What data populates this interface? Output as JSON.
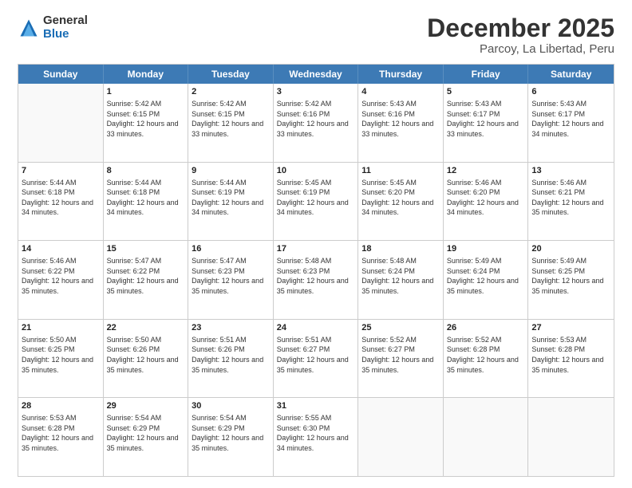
{
  "header": {
    "logo_general": "General",
    "logo_blue": "Blue",
    "title": "December 2025",
    "subtitle": "Parcoy, La Libertad, Peru"
  },
  "calendar": {
    "days_of_week": [
      "Sunday",
      "Monday",
      "Tuesday",
      "Wednesday",
      "Thursday",
      "Friday",
      "Saturday"
    ],
    "weeks": [
      [
        {
          "day": "",
          "sunrise": "",
          "sunset": "",
          "daylight": ""
        },
        {
          "day": "1",
          "sunrise": "Sunrise: 5:42 AM",
          "sunset": "Sunset: 6:15 PM",
          "daylight": "Daylight: 12 hours and 33 minutes."
        },
        {
          "day": "2",
          "sunrise": "Sunrise: 5:42 AM",
          "sunset": "Sunset: 6:15 PM",
          "daylight": "Daylight: 12 hours and 33 minutes."
        },
        {
          "day": "3",
          "sunrise": "Sunrise: 5:42 AM",
          "sunset": "Sunset: 6:16 PM",
          "daylight": "Daylight: 12 hours and 33 minutes."
        },
        {
          "day": "4",
          "sunrise": "Sunrise: 5:43 AM",
          "sunset": "Sunset: 6:16 PM",
          "daylight": "Daylight: 12 hours and 33 minutes."
        },
        {
          "day": "5",
          "sunrise": "Sunrise: 5:43 AM",
          "sunset": "Sunset: 6:17 PM",
          "daylight": "Daylight: 12 hours and 33 minutes."
        },
        {
          "day": "6",
          "sunrise": "Sunrise: 5:43 AM",
          "sunset": "Sunset: 6:17 PM",
          "daylight": "Daylight: 12 hours and 34 minutes."
        }
      ],
      [
        {
          "day": "7",
          "sunrise": "Sunrise: 5:44 AM",
          "sunset": "Sunset: 6:18 PM",
          "daylight": "Daylight: 12 hours and 34 minutes."
        },
        {
          "day": "8",
          "sunrise": "Sunrise: 5:44 AM",
          "sunset": "Sunset: 6:18 PM",
          "daylight": "Daylight: 12 hours and 34 minutes."
        },
        {
          "day": "9",
          "sunrise": "Sunrise: 5:44 AM",
          "sunset": "Sunset: 6:19 PM",
          "daylight": "Daylight: 12 hours and 34 minutes."
        },
        {
          "day": "10",
          "sunrise": "Sunrise: 5:45 AM",
          "sunset": "Sunset: 6:19 PM",
          "daylight": "Daylight: 12 hours and 34 minutes."
        },
        {
          "day": "11",
          "sunrise": "Sunrise: 5:45 AM",
          "sunset": "Sunset: 6:20 PM",
          "daylight": "Daylight: 12 hours and 34 minutes."
        },
        {
          "day": "12",
          "sunrise": "Sunrise: 5:46 AM",
          "sunset": "Sunset: 6:20 PM",
          "daylight": "Daylight: 12 hours and 34 minutes."
        },
        {
          "day": "13",
          "sunrise": "Sunrise: 5:46 AM",
          "sunset": "Sunset: 6:21 PM",
          "daylight": "Daylight: 12 hours and 35 minutes."
        }
      ],
      [
        {
          "day": "14",
          "sunrise": "Sunrise: 5:46 AM",
          "sunset": "Sunset: 6:22 PM",
          "daylight": "Daylight: 12 hours and 35 minutes."
        },
        {
          "day": "15",
          "sunrise": "Sunrise: 5:47 AM",
          "sunset": "Sunset: 6:22 PM",
          "daylight": "Daylight: 12 hours and 35 minutes."
        },
        {
          "day": "16",
          "sunrise": "Sunrise: 5:47 AM",
          "sunset": "Sunset: 6:23 PM",
          "daylight": "Daylight: 12 hours and 35 minutes."
        },
        {
          "day": "17",
          "sunrise": "Sunrise: 5:48 AM",
          "sunset": "Sunset: 6:23 PM",
          "daylight": "Daylight: 12 hours and 35 minutes."
        },
        {
          "day": "18",
          "sunrise": "Sunrise: 5:48 AM",
          "sunset": "Sunset: 6:24 PM",
          "daylight": "Daylight: 12 hours and 35 minutes."
        },
        {
          "day": "19",
          "sunrise": "Sunrise: 5:49 AM",
          "sunset": "Sunset: 6:24 PM",
          "daylight": "Daylight: 12 hours and 35 minutes."
        },
        {
          "day": "20",
          "sunrise": "Sunrise: 5:49 AM",
          "sunset": "Sunset: 6:25 PM",
          "daylight": "Daylight: 12 hours and 35 minutes."
        }
      ],
      [
        {
          "day": "21",
          "sunrise": "Sunrise: 5:50 AM",
          "sunset": "Sunset: 6:25 PM",
          "daylight": "Daylight: 12 hours and 35 minutes."
        },
        {
          "day": "22",
          "sunrise": "Sunrise: 5:50 AM",
          "sunset": "Sunset: 6:26 PM",
          "daylight": "Daylight: 12 hours and 35 minutes."
        },
        {
          "day": "23",
          "sunrise": "Sunrise: 5:51 AM",
          "sunset": "Sunset: 6:26 PM",
          "daylight": "Daylight: 12 hours and 35 minutes."
        },
        {
          "day": "24",
          "sunrise": "Sunrise: 5:51 AM",
          "sunset": "Sunset: 6:27 PM",
          "daylight": "Daylight: 12 hours and 35 minutes."
        },
        {
          "day": "25",
          "sunrise": "Sunrise: 5:52 AM",
          "sunset": "Sunset: 6:27 PM",
          "daylight": "Daylight: 12 hours and 35 minutes."
        },
        {
          "day": "26",
          "sunrise": "Sunrise: 5:52 AM",
          "sunset": "Sunset: 6:28 PM",
          "daylight": "Daylight: 12 hours and 35 minutes."
        },
        {
          "day": "27",
          "sunrise": "Sunrise: 5:53 AM",
          "sunset": "Sunset: 6:28 PM",
          "daylight": "Daylight: 12 hours and 35 minutes."
        }
      ],
      [
        {
          "day": "28",
          "sunrise": "Sunrise: 5:53 AM",
          "sunset": "Sunset: 6:28 PM",
          "daylight": "Daylight: 12 hours and 35 minutes."
        },
        {
          "day": "29",
          "sunrise": "Sunrise: 5:54 AM",
          "sunset": "Sunset: 6:29 PM",
          "daylight": "Daylight: 12 hours and 35 minutes."
        },
        {
          "day": "30",
          "sunrise": "Sunrise: 5:54 AM",
          "sunset": "Sunset: 6:29 PM",
          "daylight": "Daylight: 12 hours and 35 minutes."
        },
        {
          "day": "31",
          "sunrise": "Sunrise: 5:55 AM",
          "sunset": "Sunset: 6:30 PM",
          "daylight": "Daylight: 12 hours and 34 minutes."
        },
        {
          "day": "",
          "sunrise": "",
          "sunset": "",
          "daylight": ""
        },
        {
          "day": "",
          "sunrise": "",
          "sunset": "",
          "daylight": ""
        },
        {
          "day": "",
          "sunrise": "",
          "sunset": "",
          "daylight": ""
        }
      ]
    ]
  }
}
